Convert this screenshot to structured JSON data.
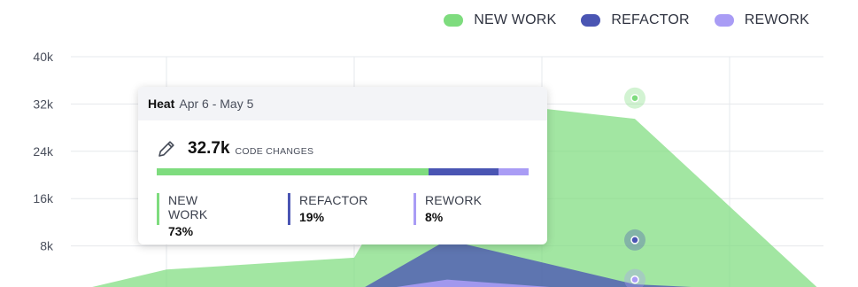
{
  "chart_data": {
    "type": "area",
    "x": [
      "",
      "",
      "",
      "Apr 6 - May 5",
      "",
      ""
    ],
    "series": [
      {
        "name": "NEW WORK",
        "color": "#7edc7e",
        "values": [
          200,
          4000,
          6000,
          33000,
          29500,
          0
        ]
      },
      {
        "name": "REFACTOR",
        "color": "#4a55b3",
        "values": [
          0,
          0,
          0,
          9000,
          1500,
          0
        ]
      },
      {
        "name": "REWORK",
        "color": "#a99cf5",
        "values": [
          0,
          0,
          0,
          2300,
          0,
          0
        ]
      }
    ],
    "ylim": [
      0,
      40000
    ],
    "yticks": [
      "8k",
      "16k",
      "24k",
      "32k",
      "40k"
    ],
    "grid": true,
    "legend": "top-right"
  },
  "legend": [
    {
      "label": "NEW WORK",
      "color": "#7edc7e"
    },
    {
      "label": "REFACTOR",
      "color": "#4a55b3"
    },
    {
      "label": "REWORK",
      "color": "#a99cf5"
    }
  ],
  "tooltip": {
    "title": "Heat",
    "range": "Apr 6 - May 5",
    "value": "32.7k",
    "unit": "CODE CHANGES",
    "icon": "pencil-icon",
    "breakdown": [
      {
        "label": "NEW WORK",
        "pct": "73%",
        "fraction": 0.73,
        "color": "#7edc7e"
      },
      {
        "label": "REFACTOR",
        "pct": "19%",
        "fraction": 0.19,
        "color": "#4a55b3"
      },
      {
        "label": "REWORK",
        "pct": "8%",
        "fraction": 0.08,
        "color": "#a99cf5"
      }
    ]
  }
}
